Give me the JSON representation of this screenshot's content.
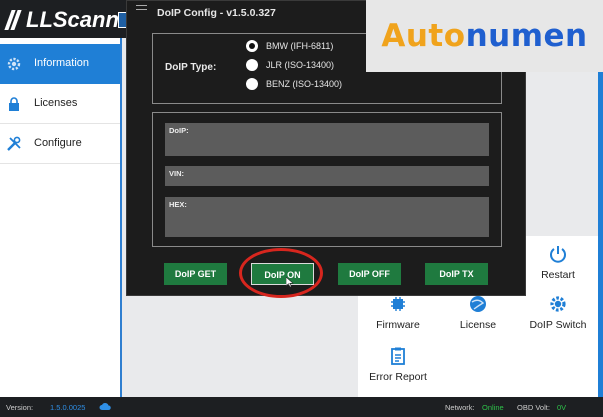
{
  "app": {
    "logo_text": "LLScanner",
    "sidebar": [
      {
        "label": "Information",
        "icon": "gear-icon",
        "active": true
      },
      {
        "label": "Licenses",
        "icon": "lock-icon",
        "active": false
      },
      {
        "label": "Configure",
        "icon": "tools-icon",
        "active": false
      }
    ],
    "tiles": [
      {
        "label": "Restart",
        "icon": "power-icon"
      },
      {
        "label": "Firmware",
        "icon": "chip-icon"
      },
      {
        "label": "License",
        "icon": "globe-icon"
      },
      {
        "label": "DoIP Switch",
        "icon": "gear-icon"
      },
      {
        "label": "Error Report",
        "icon": "clipboard-icon"
      }
    ],
    "status": {
      "version_label": "Version:",
      "version_value": "1.5.0.0025",
      "network_label": "Network:",
      "network_value": "Online",
      "obd_label": "OBD Volt:",
      "obd_value": "0V"
    },
    "colors": {
      "accent": "#1f7fd6",
      "button_green": "#1f7a3f",
      "highlight_red": "#d7261e"
    }
  },
  "dialog": {
    "title": "DoIP Config - v1.5.0.327",
    "doip_type_label": "DoIP Type:",
    "options": [
      {
        "label": "BMW (IFH-6811)",
        "selected": true
      },
      {
        "label": "JLR (ISO-13400)",
        "selected": false
      },
      {
        "label": "BENZ (ISO-13400)",
        "selected": false
      }
    ],
    "fields": {
      "doip_label": "DoIP:",
      "vin_label": "VIN:",
      "hex_label": "HEX:"
    },
    "buttons": {
      "get": "DoIP GET",
      "on": "DoIP ON",
      "off": "DoIP OFF",
      "tx": "DoIP TX"
    }
  },
  "watermark": {
    "part1": "Auto",
    "part2": "numen"
  }
}
